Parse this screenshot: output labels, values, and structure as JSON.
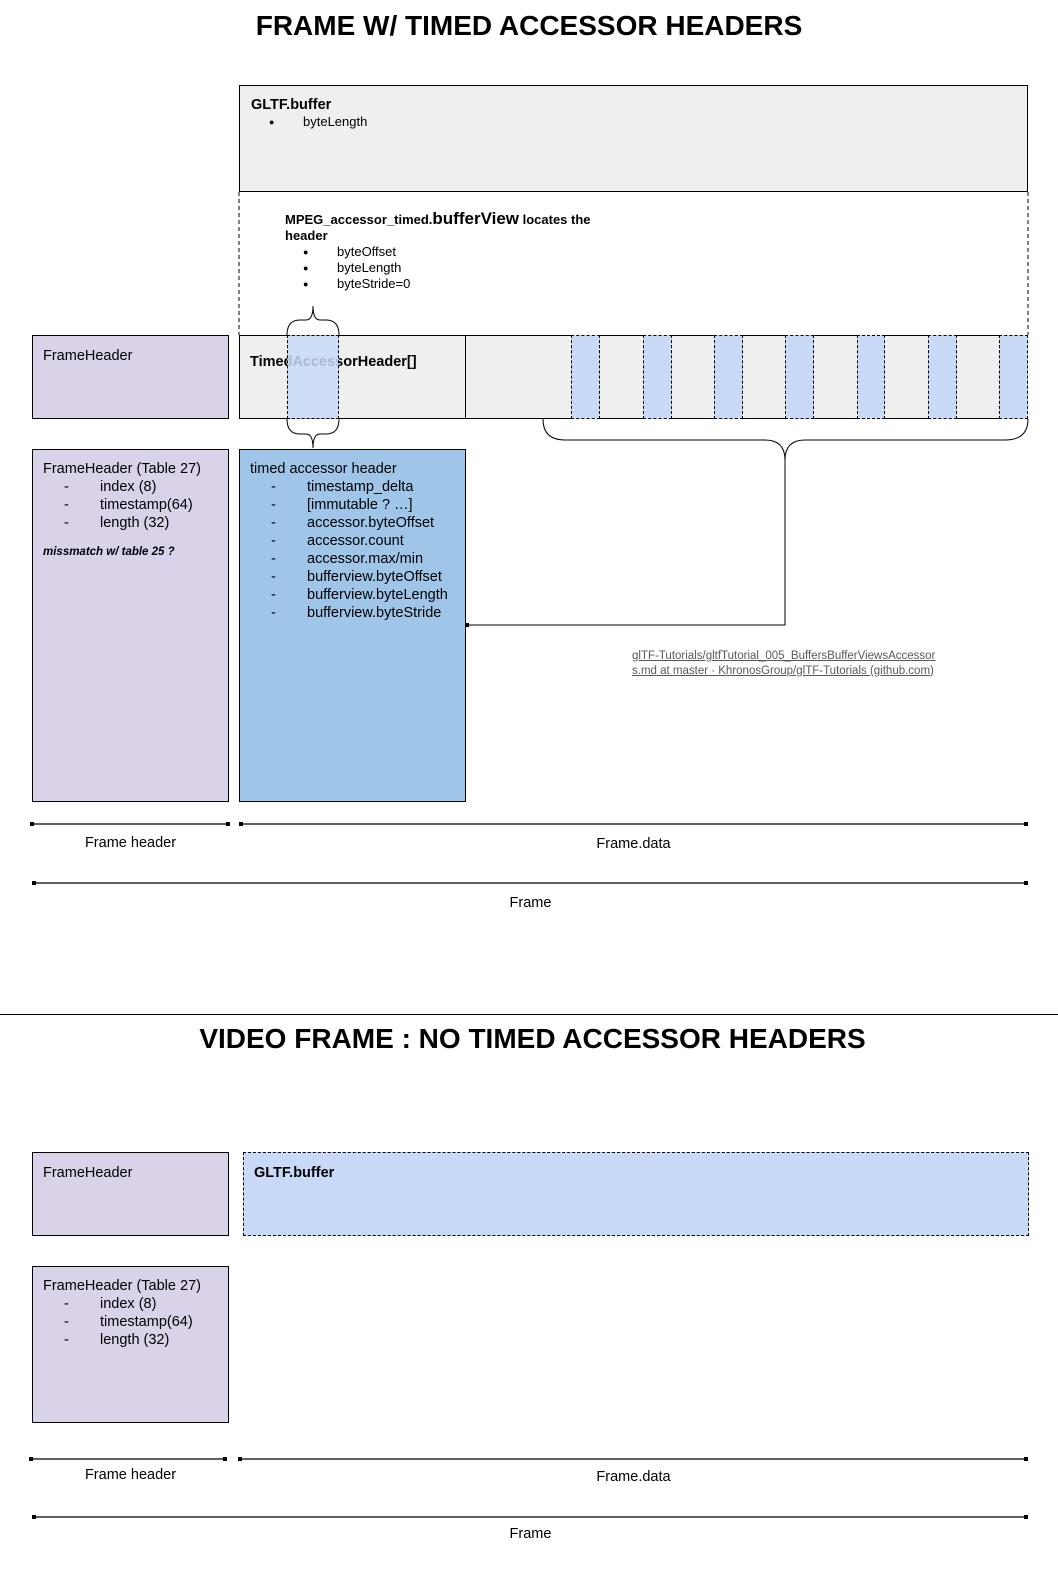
{
  "section1": {
    "title": "FRAME W/ TIMED ACCESSOR HEADERS",
    "gltf_buffer": {
      "title": "GLTF.buffer",
      "items": [
        "byteLength"
      ]
    },
    "buffer_view_note": {
      "prefix": "MPEG_accessor_timed.",
      "big": "bufferView",
      "suffix": " locates the header",
      "items": [
        "byteOffset",
        "byteLength",
        "byteStride=0"
      ]
    },
    "frame_header_short": "FrameHeader",
    "timed_accessor_header_array": "TimedAccessorHeader[]",
    "frame_header_table": {
      "title": "FrameHeader (Table 27)",
      "items": [
        "index (8)",
        "timestamp(64)",
        "length (32)"
      ],
      "note": "missmatch w/ table 25 ?"
    },
    "timed_accessor_header": {
      "title": "timed accessor header",
      "items": [
        "timestamp_delta",
        "[immutable ? …]",
        "accessor.byteOffset",
        "accessor.count",
        "accessor.max/min",
        "bufferview.byteOffset",
        "bufferview.byteLength",
        "bufferview.byteStride"
      ]
    },
    "link": "glTF-Tutorials/gltfTutorial_005_BuffersBufferViewsAccessors.md at master · KhronosGroup/glTF-Tutorials (github.com)",
    "scale": {
      "frame_header": "Frame header",
      "frame_data": "Frame.data",
      "frame": "Frame"
    }
  },
  "section2": {
    "title": "VIDEO FRAME : NO TIMED ACCESSOR HEADERS",
    "frame_header_short": "FrameHeader",
    "gltf_buffer": "GLTF.buffer",
    "frame_header_table": {
      "title": "FrameHeader (Table 27)",
      "items": [
        "index (8)",
        "timestamp(64)",
        "length (32)"
      ]
    },
    "scale": {
      "frame_header": "Frame header",
      "frame_data": "Frame.data",
      "frame": "Frame"
    }
  },
  "colors": {
    "gray": "#efefef",
    "purple": "#d9d2e9",
    "blue": "#9fc5e8",
    "light_blue": "#c9daf8"
  }
}
